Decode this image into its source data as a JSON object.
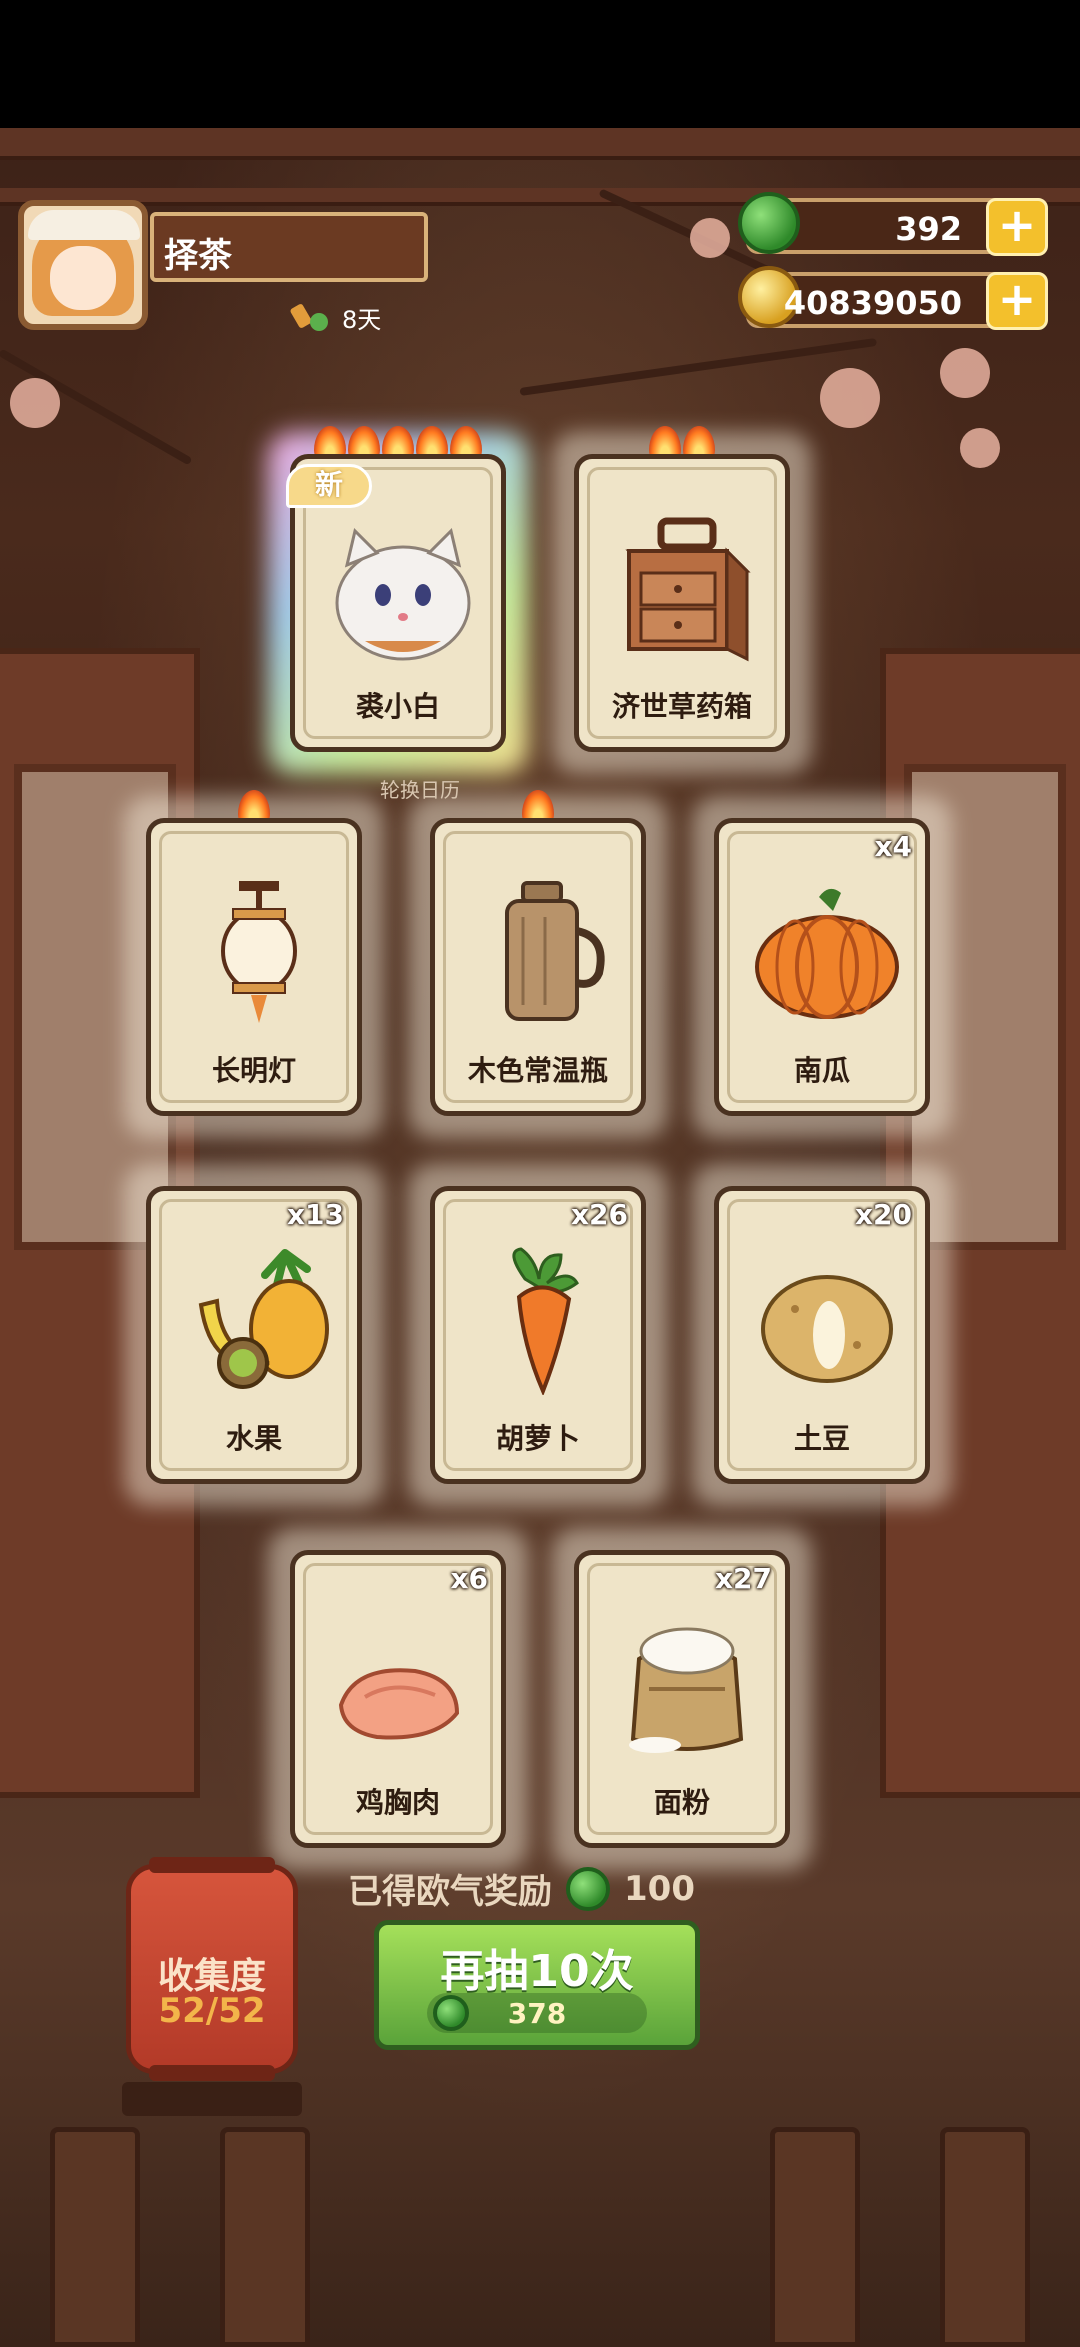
{
  "player": {
    "name": "择茶",
    "days": "8天"
  },
  "currency": {
    "jade": "392",
    "gold": "40839050"
  },
  "cards": [
    {
      "label": "裘小白",
      "flames": 5,
      "new": "新",
      "count": "",
      "icon": "white-cat-icon"
    },
    {
      "label": "济世草药箱",
      "flames": 2,
      "count": "",
      "icon": "medicine-box-icon"
    },
    {
      "label": "长明灯",
      "flames": 1,
      "count": "",
      "icon": "lantern-icon"
    },
    {
      "label": "木色常温瓶",
      "flames": 1,
      "count": "",
      "icon": "thermos-icon"
    },
    {
      "label": "南瓜",
      "flames": 0,
      "count": "x4",
      "icon": "pumpkin-icon"
    },
    {
      "label": "水果",
      "flames": 0,
      "count": "x13",
      "icon": "fruit-icon"
    },
    {
      "label": "胡萝卜",
      "flames": 0,
      "count": "x26",
      "icon": "carrot-icon"
    },
    {
      "label": "土豆",
      "flames": 0,
      "count": "x20",
      "icon": "potato-icon"
    },
    {
      "label": "鸡胸肉",
      "flames": 0,
      "count": "x6",
      "icon": "chicken-breast-icon"
    },
    {
      "label": "面粉",
      "flames": 0,
      "count": "x27",
      "icon": "flour-sack-icon"
    }
  ],
  "rotate_label": "轮换日历",
  "reward": {
    "text": "已得欧气奖励",
    "value": "100"
  },
  "redraw": {
    "label": "再抽10次",
    "cost": "378"
  },
  "collection": {
    "label": "收集度",
    "progress": "52/52"
  }
}
